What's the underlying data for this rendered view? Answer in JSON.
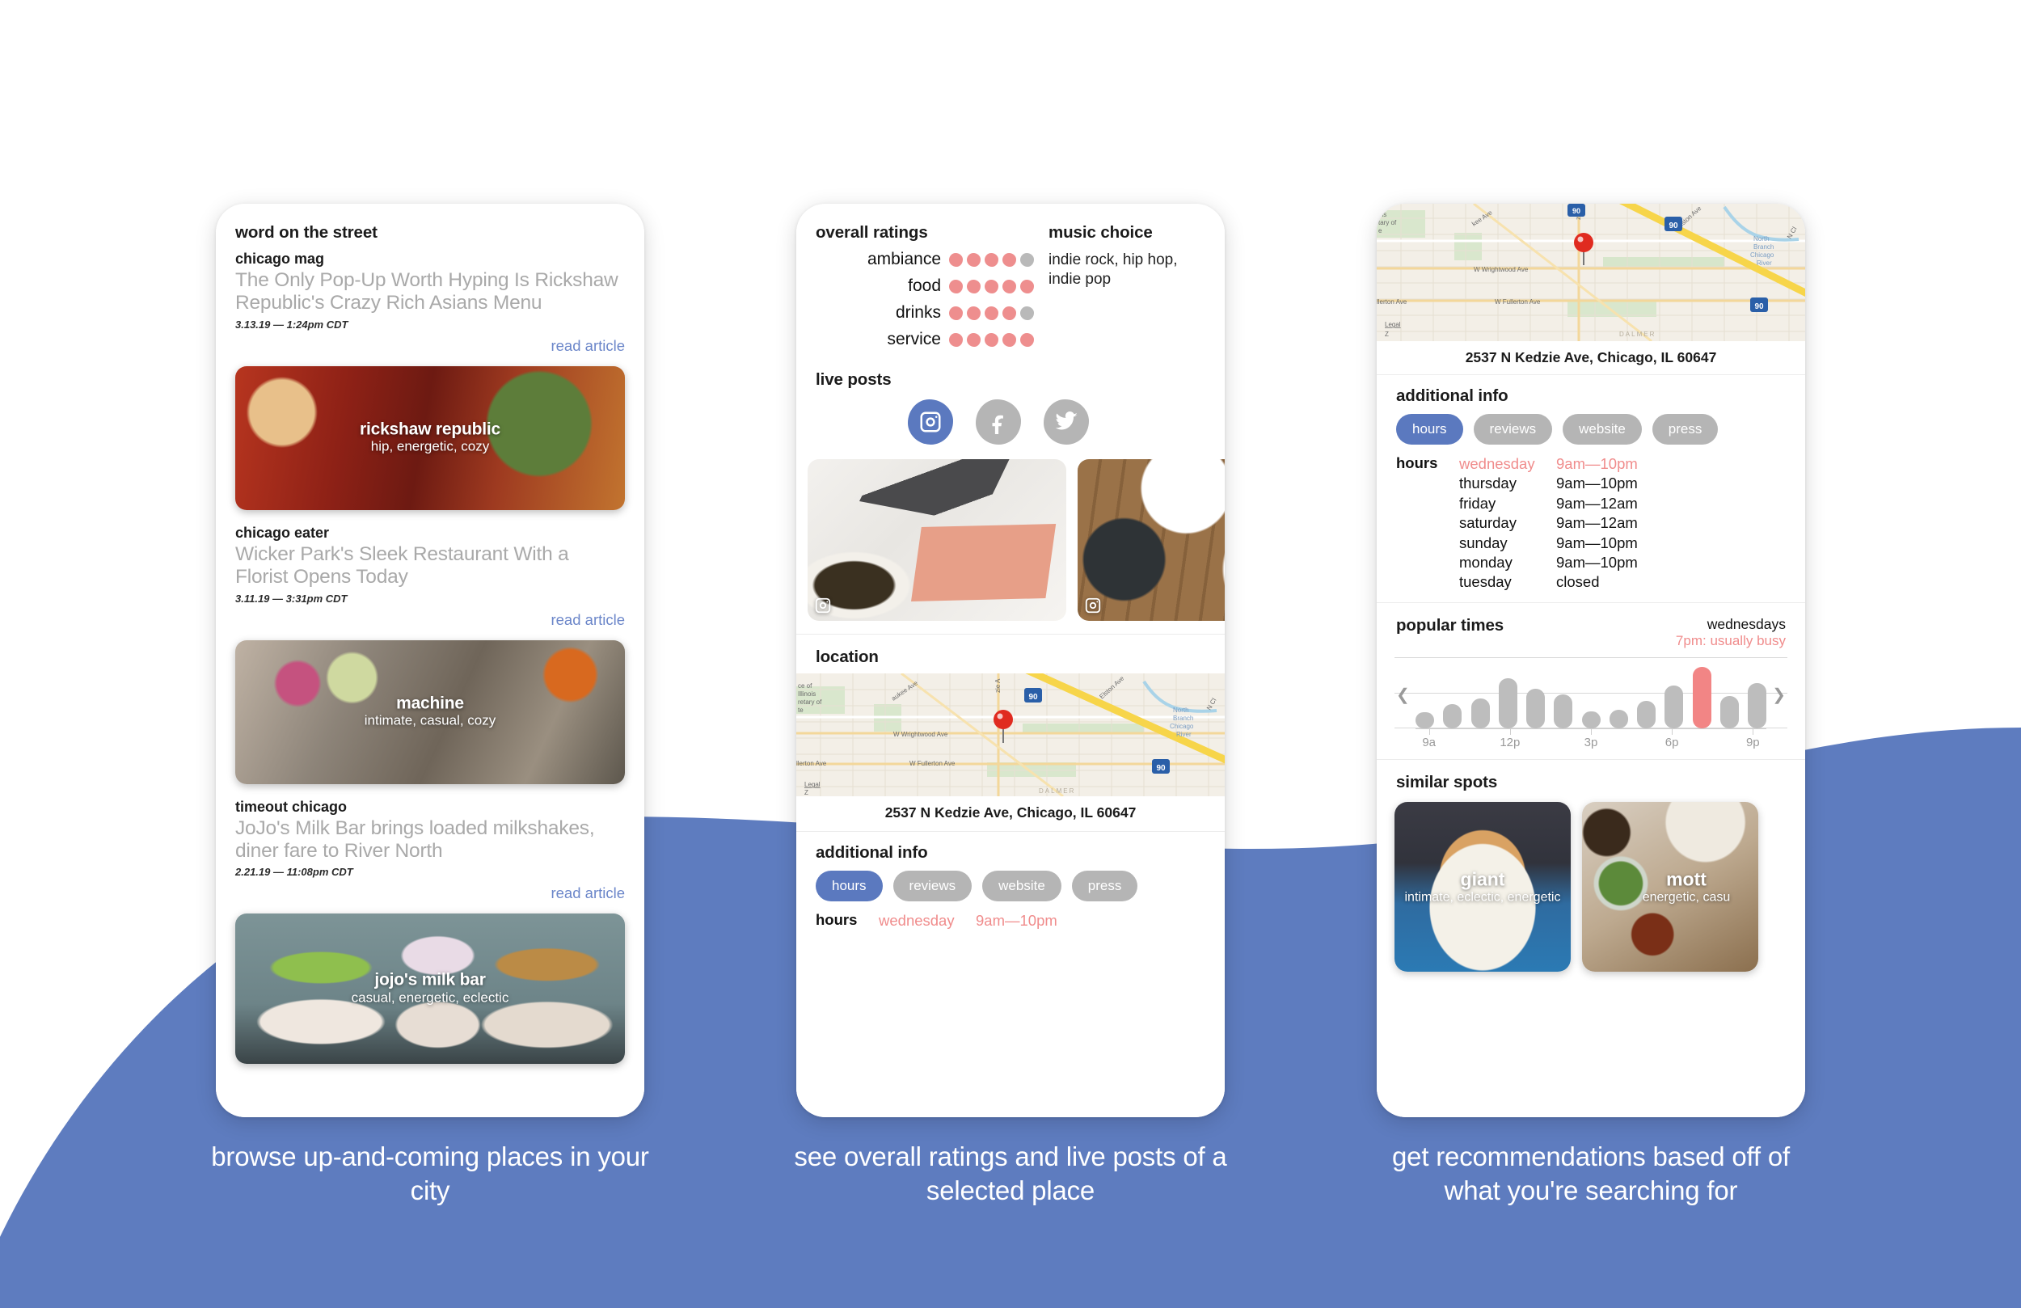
{
  "theme": {
    "wave_color": "#5e7cbf",
    "accent_blue": "#5b79bf",
    "accent_pink": "#ee8e8e",
    "muted_gray": "#b5b5b5",
    "link_blue": "#6b86c9",
    "title_gray": "#a9a9a9"
  },
  "phone1": {
    "header": "word on the street",
    "articles": [
      {
        "source": "chicago mag",
        "title": "The Only Pop-Up Worth Hyping Is Rickshaw Republic's Crazy Rich Asians Menu",
        "date": "3.13.19 — 1:24pm CDT",
        "link": "read article",
        "place": {
          "name": "rickshaw republic",
          "tags": "hip, energetic, cozy"
        }
      },
      {
        "source": "chicago eater",
        "title": "Wicker Park's Sleek Restaurant With a Florist Opens Today",
        "date": "3.11.19 — 3:31pm CDT",
        "link": "read article",
        "place": {
          "name": "machine",
          "tags": "intimate, casual, cozy"
        }
      },
      {
        "source": "timeout chicago",
        "title": "JoJo's Milk Bar brings loaded milkshakes, diner fare to River North",
        "date": "2.21.19 — 11:08pm CDT",
        "link": "read article",
        "place": {
          "name": "jojo's milk bar",
          "tags": "casual, energetic, eclectic"
        }
      }
    ],
    "caption": "browse up-and-coming places in your city"
  },
  "phone2": {
    "ratings_title": "overall ratings",
    "ratings": [
      {
        "label": "ambiance",
        "value": 4,
        "max": 5
      },
      {
        "label": "food",
        "value": 5,
        "max": 5
      },
      {
        "label": "drinks",
        "value": 4,
        "max": 5
      },
      {
        "label": "service",
        "value": 5,
        "max": 5
      }
    ],
    "music_title": "music choice",
    "music_value": "indie rock, hip hop, indie pop",
    "live_posts_title": "live posts",
    "socials": [
      {
        "name": "instagram",
        "active": true
      },
      {
        "name": "facebook",
        "active": false
      },
      {
        "name": "twitter",
        "active": false
      }
    ],
    "location_title": "location",
    "address": "2537 N Kedzie Ave, Chicago, IL 60647",
    "map_labels": [
      "ce of",
      "Illinois",
      "retary of",
      "te",
      "aukee Ave",
      "zie A",
      "Elston Ave",
      "W Wrightwood Ave",
      "W Fullerton Ave",
      "llerton Ave",
      "Legal",
      "North Branch Chicago River",
      "N Cl",
      "DALMER",
      "90"
    ],
    "additional_info_title": "additional info",
    "tabs": [
      {
        "label": "hours",
        "active": true
      },
      {
        "label": "reviews",
        "active": false
      },
      {
        "label": "website",
        "active": false
      },
      {
        "label": "press",
        "active": false
      }
    ],
    "hours_label": "hours",
    "hours": [
      {
        "day": "wednesday",
        "time": "9am—10pm",
        "today": true
      }
    ],
    "caption": "see overall ratings and live posts of a selected place"
  },
  "phone3": {
    "address": "2537 N Kedzie Ave, Chicago, IL 60647",
    "additional_info_title": "additional info",
    "tabs": [
      {
        "label": "hours",
        "active": true
      },
      {
        "label": "reviews",
        "active": false
      },
      {
        "label": "website",
        "active": false
      },
      {
        "label": "press",
        "active": false
      }
    ],
    "hours_label": "hours",
    "hours": [
      {
        "day": "wednesday",
        "time": "9am—10pm",
        "today": true
      },
      {
        "day": "thursday",
        "time": "9am—10pm",
        "today": false
      },
      {
        "day": "friday",
        "time": "9am—12am",
        "today": false
      },
      {
        "day": "saturday",
        "time": "9am—12am",
        "today": false
      },
      {
        "day": "sunday",
        "time": "9am—10pm",
        "today": false
      },
      {
        "day": "monday",
        "time": "9am—10pm",
        "today": false
      },
      {
        "day": "tuesday",
        "time": "closed",
        "today": false
      }
    ],
    "popular_times_title": "popular times",
    "popular_times_day": "wednesdays",
    "popular_times_note": "7pm: usually busy",
    "similar_spots_title": "similar spots",
    "similar_spots": [
      {
        "name": "giant",
        "tags": "intimate, eclectic, energetic"
      },
      {
        "name": "mott",
        "tags": "energetic, casu"
      }
    ],
    "caption": "get recommendations based off of what you're searching for"
  },
  "chart_data": {
    "type": "bar",
    "title": "popular times",
    "subtitle": "wednesdays",
    "annotation": "7pm: usually busy",
    "categories": [
      "9a",
      "10a",
      "11a",
      "12p",
      "1p",
      "2p",
      "3p",
      "4p",
      "5p",
      "6p",
      "7p",
      "8p",
      "9p"
    ],
    "values": [
      22,
      34,
      42,
      70,
      56,
      48,
      24,
      26,
      38,
      60,
      86,
      45,
      63
    ],
    "highlight_index": 10,
    "highlight_color": "#f28585",
    "bar_color": "#bdbdbd",
    "tick_labels": [
      "9a",
      "12p",
      "3p",
      "6p",
      "9p"
    ],
    "tick_indices": [
      0,
      3,
      6,
      9,
      12
    ],
    "xlabel": "",
    "ylabel": "",
    "ylim": [
      0,
      100
    ],
    "grid": true,
    "legend": "none"
  }
}
